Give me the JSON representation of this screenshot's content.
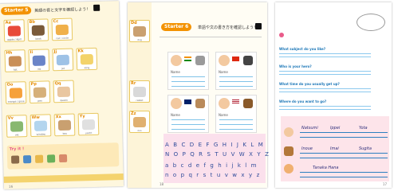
{
  "pageA": {
    "tab": "Starter 5",
    "title": "英語の音と文字を確認しよう！",
    "cells": [
      {
        "letter": "Aa",
        "word": "apple / April"
      },
      {
        "letter": "Bb",
        "word": "book"
      },
      {
        "letter": "Cc",
        "word": "cat / circle"
      },
      {
        "letter": "Hh",
        "word": "hat"
      },
      {
        "letter": "Ii",
        "word": "ink"
      },
      {
        "letter": "Jj",
        "word": "jet"
      },
      {
        "letter": "Kk",
        "word": "king"
      },
      {
        "letter": "Oo",
        "word": "orange / gone"
      },
      {
        "letter": "Pp",
        "word": "pen"
      },
      {
        "letter": "Qq",
        "word": "queen"
      },
      {
        "letter": "Vv",
        "word": "vet"
      },
      {
        "letter": "Ww",
        "word": "window"
      },
      {
        "letter": "Xx",
        "word": "box"
      },
      {
        "letter": "Yy",
        "word": "yacht"
      }
    ],
    "try_label": "Try it !",
    "page_num": "16"
  },
  "pageB": {
    "tab": "Starter 6",
    "title": "単語や文の書き方を確認しよう！",
    "cards_label": "Name",
    "upper": "A B C D E F G H I J K L M",
    "upper2": "N O P Q R S T U V W X Y Z",
    "lower": "a b c d e f g h i j k l m",
    "lower2": "n o p q r s t u v w x y z",
    "side_cells": [
      {
        "letter": "Dd",
        "word": "dog"
      },
      {
        "letter": "Rr",
        "word": "rabbit"
      },
      {
        "letter": "Zz",
        "word": "zoo"
      }
    ],
    "page_num": "18"
  },
  "pageC": {
    "questions": [
      "What subject do you like?",
      "Who is your hero?",
      "What time do you usually get up?",
      "Where do you want to go?"
    ],
    "names": [
      "Natsumi",
      "Ippei",
      "Yota",
      "Inoue",
      "Imai",
      "Sugita",
      "Tanaka Hana"
    ],
    "page_num": "17"
  },
  "colors": {
    "orange": "#f39200",
    "pink": "#e95b8a",
    "teal": "#1ea1a8",
    "blue": "#1e78b8"
  }
}
